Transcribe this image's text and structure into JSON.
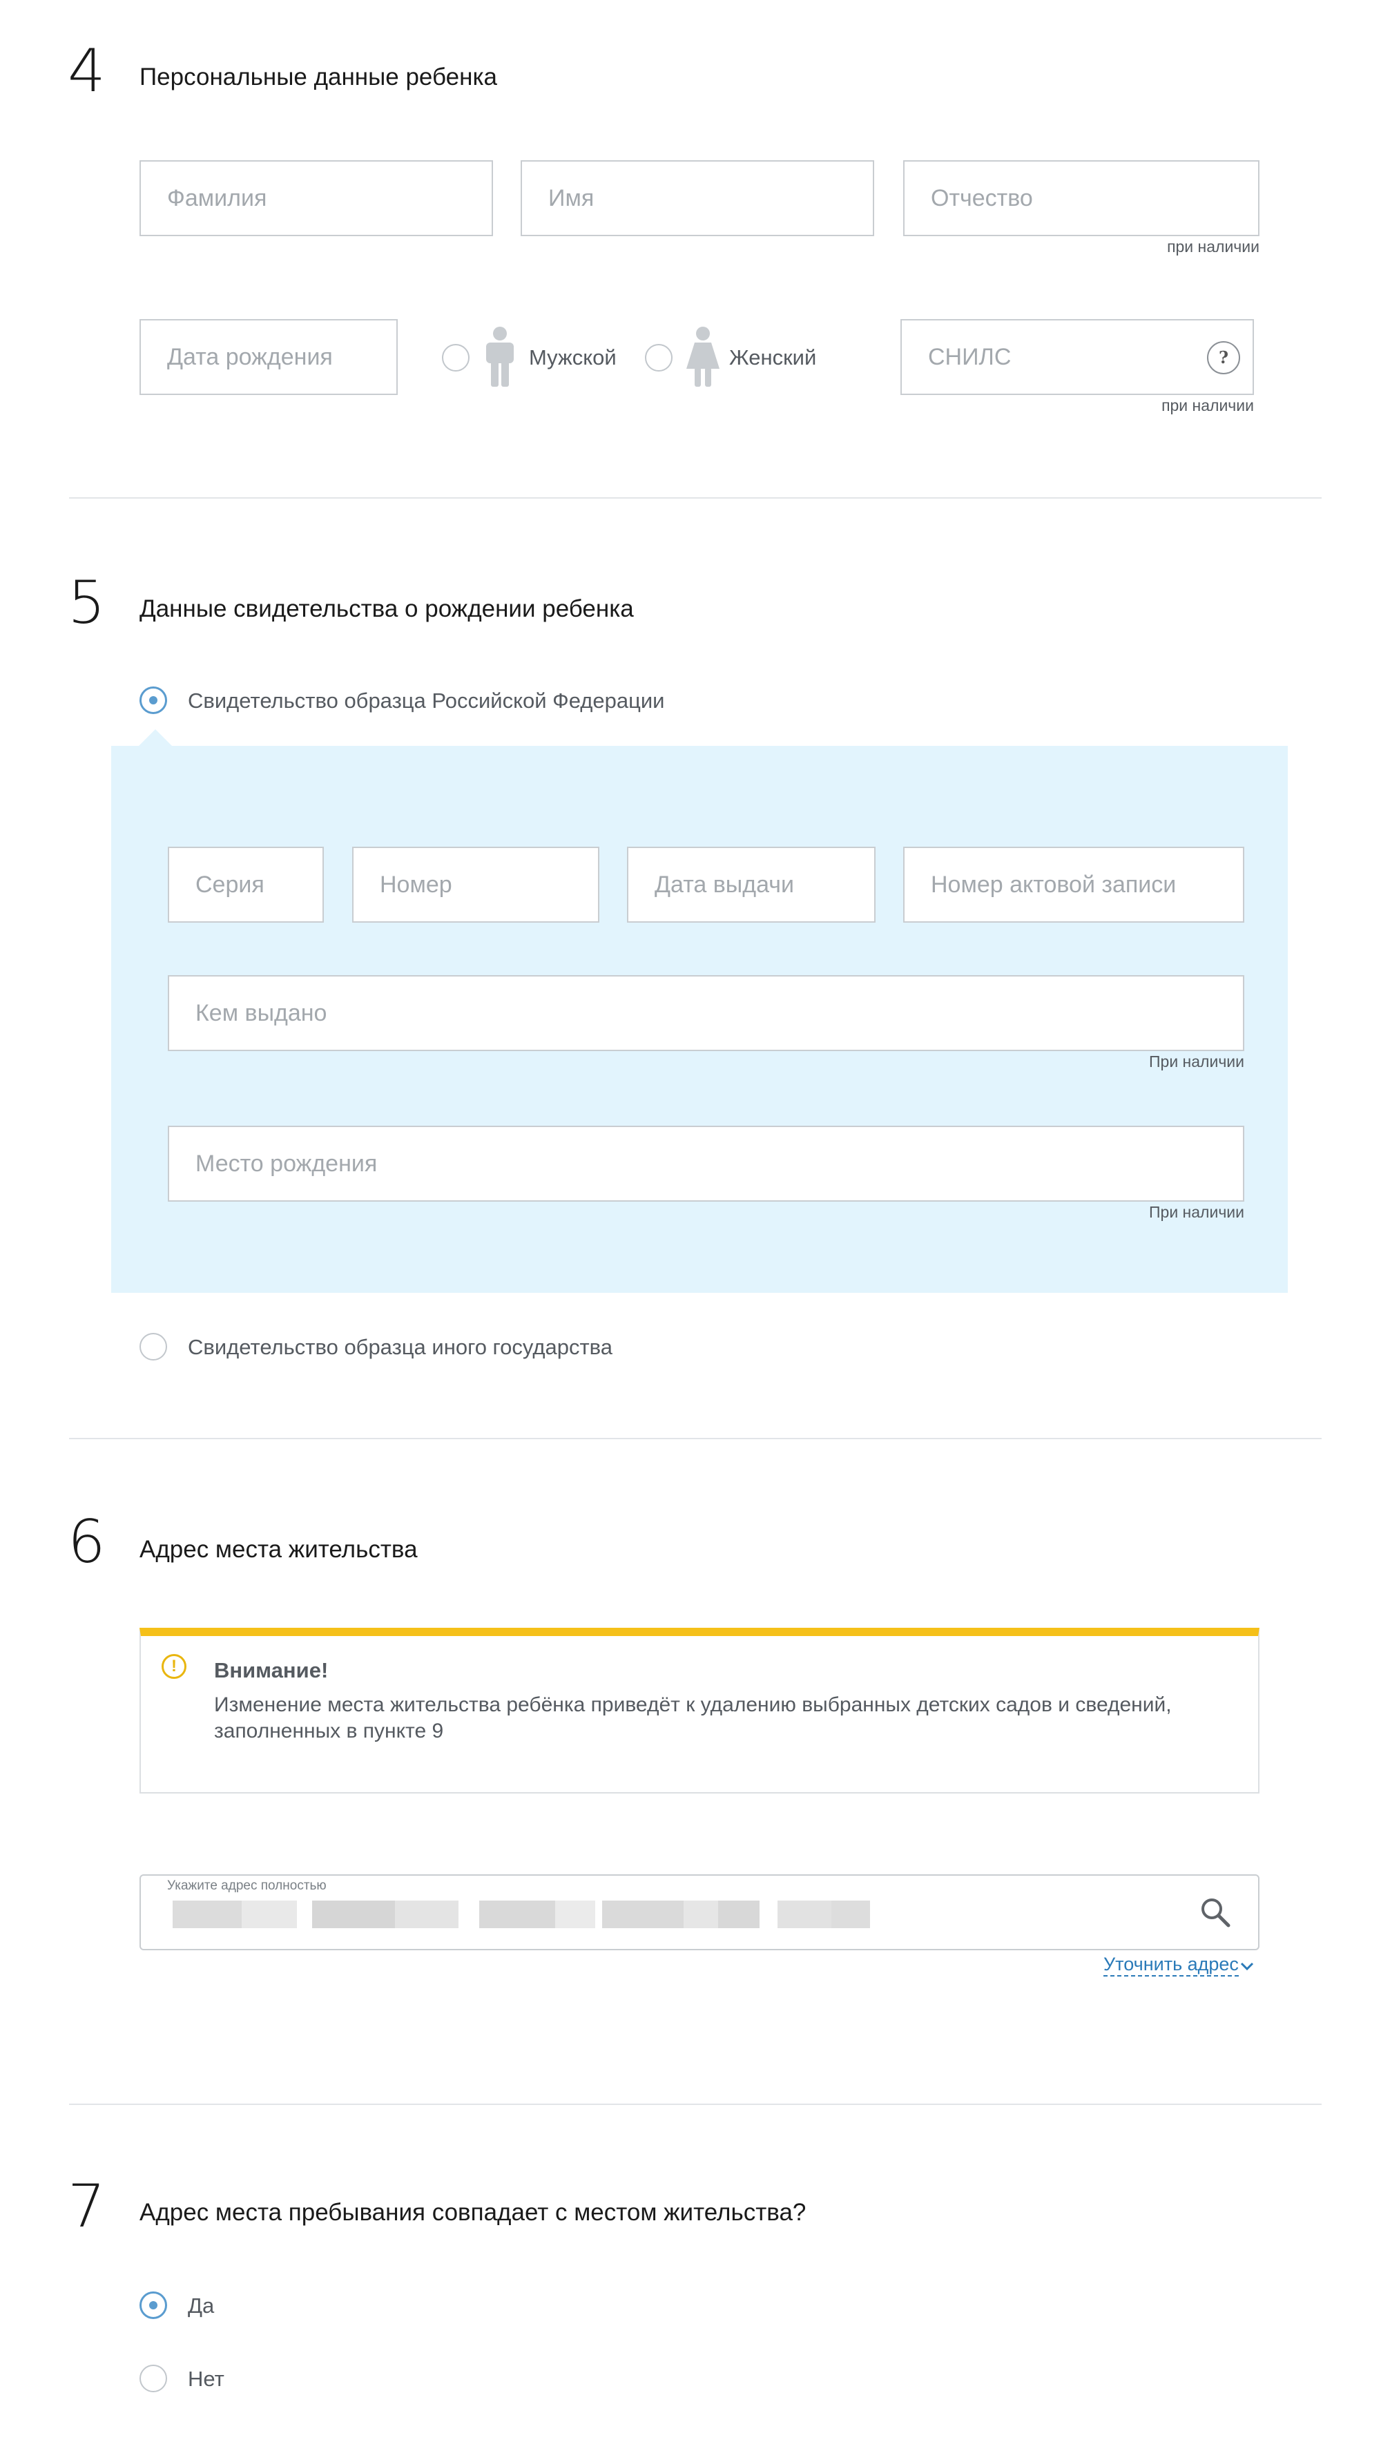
{
  "sections": {
    "s4": {
      "number": "4",
      "title": "Персональные данные ребенка",
      "last_name_placeholder": "Фамилия",
      "first_name_placeholder": "Имя",
      "patronymic_placeholder": "Отчество",
      "patronymic_hint": "при наличии",
      "birth_date_placeholder": "Дата рождения",
      "gender_male": "Мужской",
      "gender_female": "Женский",
      "gender_selected": "",
      "snils_placeholder": "СНИЛС",
      "snils_hint": "при наличии",
      "snils_help_icon": "?"
    },
    "s5": {
      "number": "5",
      "title": "Данные свидетельства о рождении ребенка",
      "option_rf": "Свидетельство образца Российской Федерации",
      "option_foreign": "Свидетельство образца иного государства",
      "selected": "option_rf",
      "series_placeholder": "Серия",
      "number_placeholder": "Номер",
      "issue_date_placeholder": "Дата выдачи",
      "record_number_placeholder": "Номер актовой записи",
      "issued_by_placeholder": "Кем выдано",
      "issued_by_hint": "При наличии",
      "birth_place_placeholder": "Место рождения",
      "birth_place_hint": "При наличии",
      "panel_color": "#e2f4fd"
    },
    "s6": {
      "number": "6",
      "title": "Адрес места жительства",
      "warning_title": "Внимание!",
      "warning_text_line1": "Изменение места жительства ребёнка приведёт к удалению выбранных детских садов и сведений,",
      "warning_text_line2": "заполненных в пункте 9",
      "warning_accent": "#f5c019",
      "address_label": "Укажите адрес полностью",
      "clarify_link": "Уточнить адрес"
    },
    "s7": {
      "number": "7",
      "title": "Адрес места пребывания совпадает с местом жительства?",
      "option_yes": "Да",
      "option_no": "Нет",
      "selected": "option_yes"
    }
  },
  "icons": {
    "male": "male-person-icon",
    "female": "female-person-icon",
    "search": "search-icon",
    "warning": "warning-icon",
    "chevron": "chevron-down-icon"
  },
  "colors": {
    "radio_selected": "#5a9ccf",
    "link": "#2a7ab8"
  }
}
